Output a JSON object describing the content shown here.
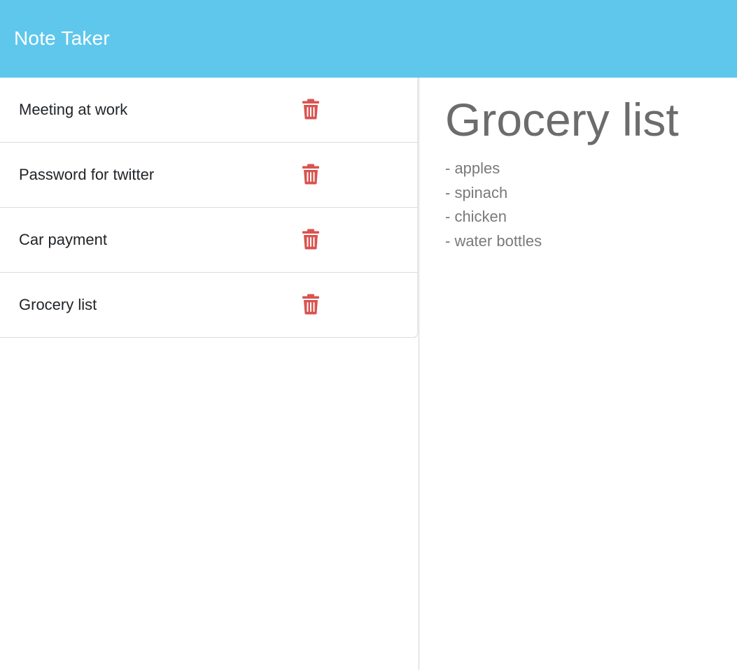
{
  "header": {
    "title": "Note Taker",
    "background_color": "#5fc7ec"
  },
  "sidebar": {
    "notes": [
      {
        "title": "Meeting at work",
        "delete_icon": "trash-icon"
      },
      {
        "title": "Password for twitter",
        "delete_icon": "trash-icon"
      },
      {
        "title": "Car payment",
        "delete_icon": "trash-icon"
      },
      {
        "title": "Grocery list",
        "delete_icon": "trash-icon"
      }
    ],
    "delete_icon_color": "#d9534f"
  },
  "editor": {
    "title": "Grocery list",
    "body_lines": [
      "- apples",
      "- spinach",
      "- chicken",
      "- water bottles"
    ]
  }
}
